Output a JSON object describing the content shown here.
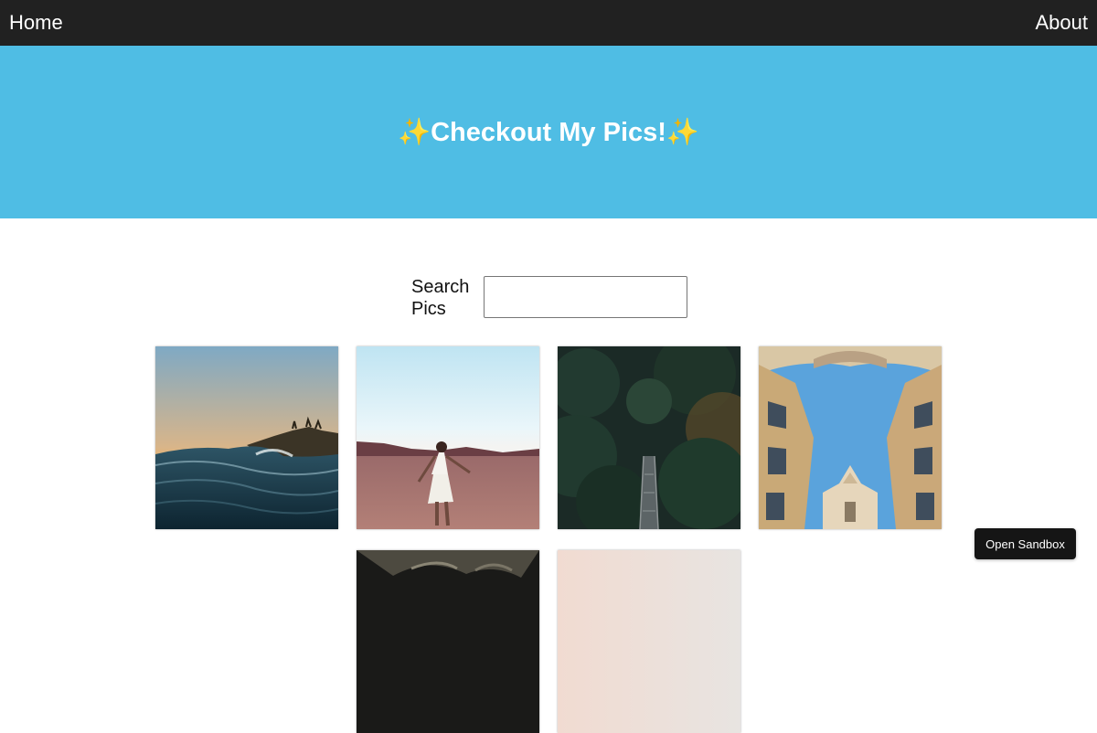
{
  "nav": {
    "home_label": "Home",
    "about_label": "About"
  },
  "hero": {
    "title": "✨Checkout My Pics!✨",
    "background_color": "#4fbde4"
  },
  "search": {
    "label": "Search Pics",
    "value": "",
    "placeholder": ""
  },
  "gallery": {
    "images": [
      {
        "subject": "ocean-wave-at-sunset"
      },
      {
        "subject": "woman-in-white-dress-on-beach"
      },
      {
        "subject": "suspension-bridge-in-forest"
      },
      {
        "subject": "looking-up-between-buildings"
      },
      {
        "subject": "dark-partial-image"
      },
      {
        "subject": "light-partial-image"
      }
    ]
  },
  "sandbox": {
    "button_label": "Open Sandbox"
  },
  "colors": {
    "topbar": "#212121",
    "hero": "#4fbde4",
    "sandbox_button": "#151515"
  }
}
